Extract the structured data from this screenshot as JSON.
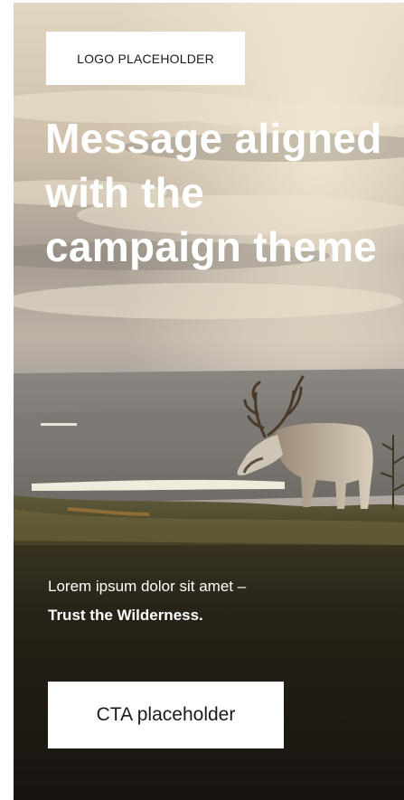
{
  "ad": {
    "logo_label": "LOGO PLACEHOLDER",
    "headline": "Message aligned with the campaign theme",
    "body_line1": "Lorem ipsum dolor sit amet –",
    "body_line2": "Trust the Wilderness.",
    "cta_label": "CTA placeholder"
  },
  "colors": {
    "sky_top": "#d9cbb4",
    "sky_mid": "#b9ad9e",
    "haze": "#a9a4a0",
    "ground_dark": "#2a2418",
    "text": "#ffffff",
    "panel": "#ffffff"
  }
}
